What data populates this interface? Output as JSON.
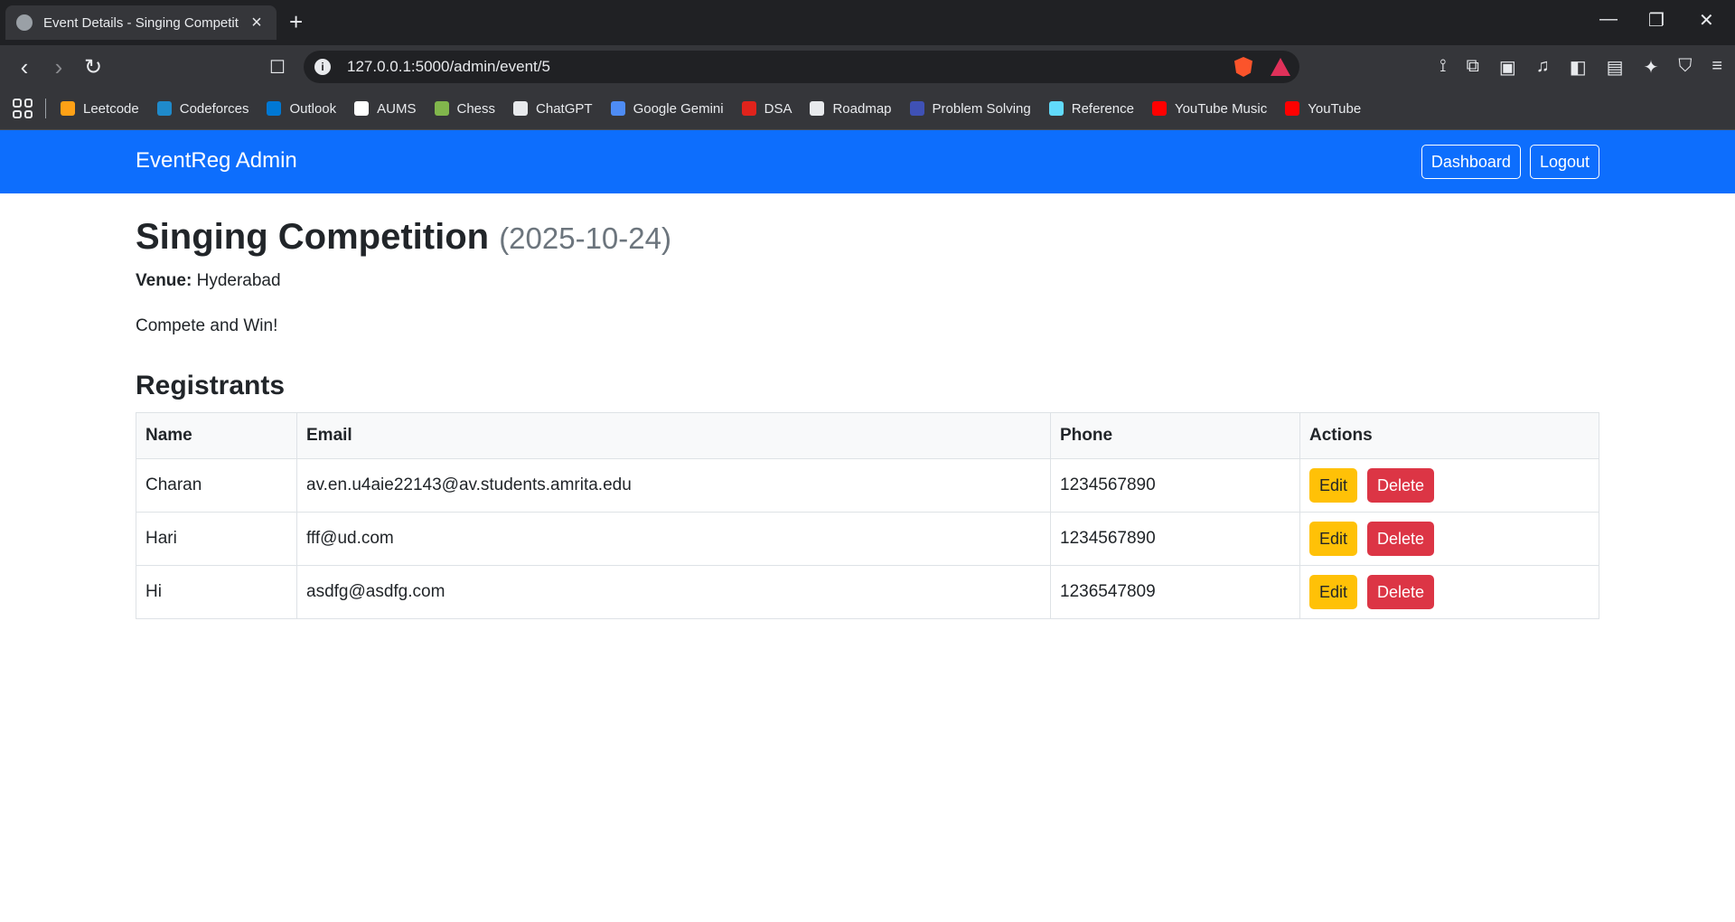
{
  "browser": {
    "tab_title": "Event Details - Singing Competit",
    "url": "127.0.0.1:5000/admin/event/5",
    "bookmarks": [
      {
        "label": "Leetcode",
        "color": "#ffa116"
      },
      {
        "label": "Codeforces",
        "color": "#1f8acb"
      },
      {
        "label": "Outlook",
        "color": "#0078d4"
      },
      {
        "label": "AUMS",
        "color": "#ffffff"
      },
      {
        "label": "Chess",
        "color": "#81b64c"
      },
      {
        "label": "ChatGPT",
        "color": "#e8eaed"
      },
      {
        "label": "Google Gemini",
        "color": "#4e8cf5"
      },
      {
        "label": "DSA",
        "color": "#e0231c"
      },
      {
        "label": "Roadmap",
        "color": "#e8eaed"
      },
      {
        "label": "Problem Solving",
        "color": "#3f51b5"
      },
      {
        "label": "Reference",
        "color": "#61dafb"
      },
      {
        "label": "YouTube Music",
        "color": "#ff0000"
      },
      {
        "label": "YouTube",
        "color": "#ff0000"
      }
    ]
  },
  "navbar": {
    "brand": "EventReg Admin",
    "dashboard_label": "Dashboard",
    "logout_label": "Logout"
  },
  "event": {
    "name": "Singing Competition",
    "date": "(2025-10-24)",
    "venue_label": "Venue:",
    "venue": "Hyderabad",
    "description": "Compete and Win!"
  },
  "registrants": {
    "title": "Registrants",
    "headers": [
      "Name",
      "Email",
      "Phone",
      "Actions"
    ],
    "edit_label": "Edit",
    "delete_label": "Delete",
    "rows": [
      {
        "name": "Charan",
        "email": "av.en.u4aie22143@av.students.amrita.edu",
        "phone": "1234567890"
      },
      {
        "name": "Hari",
        "email": "fff@ud.com",
        "phone": "1234567890"
      },
      {
        "name": "Hi",
        "email": "asdfg@asdfg.com",
        "phone": "1236547809"
      }
    ]
  }
}
